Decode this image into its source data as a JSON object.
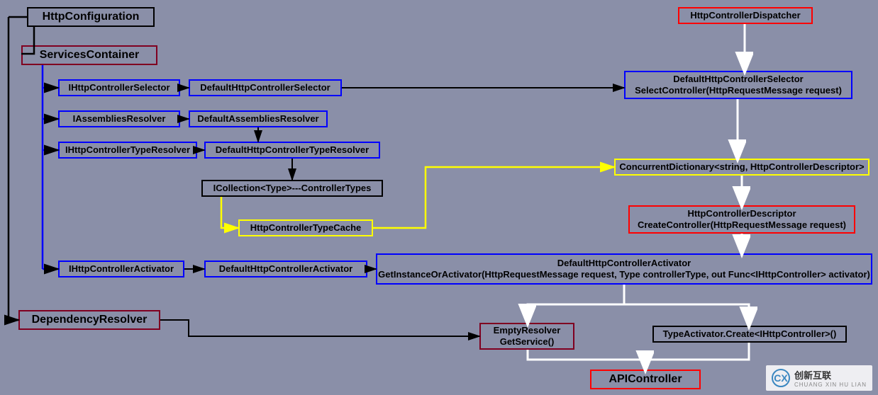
{
  "nodes": {
    "httpConfiguration": "HttpConfiguration",
    "servicesContainer": "ServicesContainer",
    "dependencyResolver": "DependencyResolver",
    "httpControllerDispatcher": "HttpControllerDispatcher",
    "iHttpControllerSelector": "IHttpControllerSelector",
    "defaultHttpControllerSelector": "DefaultHttpControllerSelector",
    "iAssembliesResolver": "IAssembliesResolver",
    "defaultAssembliesResolver": "DefaultAssembliesResolver",
    "iHttpControllerTypeResolver": "IHttpControllerTypeResolver",
    "defaultHttpControllerTypeResolver": "DefaultHttpControllerTypeResolver",
    "iCollectionControllerTypes": "ICollection<Type>---ControllerTypes",
    "httpControllerTypeCache": "HttpControllerTypeCache",
    "iHttpControllerActivator": "IHttpControllerActivator",
    "defaultHttpControllerActivator": "DefaultHttpControllerActivator",
    "selectorSelectController_l1": "DefaultHttpControllerSelector",
    "selectorSelectController_l2": "SelectController(HttpRequestMessage request)",
    "concurrentDictionary": "ConcurrentDictionary<string, HttpControllerDescriptor>",
    "httpControllerDescriptor_l1": "HttpControllerDescriptor",
    "httpControllerDescriptor_l2": "CreateController(HttpRequestMessage request)",
    "activatorGetInstance_l1": "DefaultHttpControllerActivator",
    "activatorGetInstance_l2": "GetInstanceOrActivator(HttpRequestMessage request, Type controllerType, out Func<IHttpController> activator)",
    "emptyResolver_l1": "EmptyResolver",
    "emptyResolver_l2": "GetService()",
    "typeActivatorCreate": "TypeActivator.Create<IHttpController>()",
    "apiController": "APIController"
  },
  "logo": {
    "brand": "创新互联",
    "sub": "CHUANG XIN HU LIAN"
  }
}
